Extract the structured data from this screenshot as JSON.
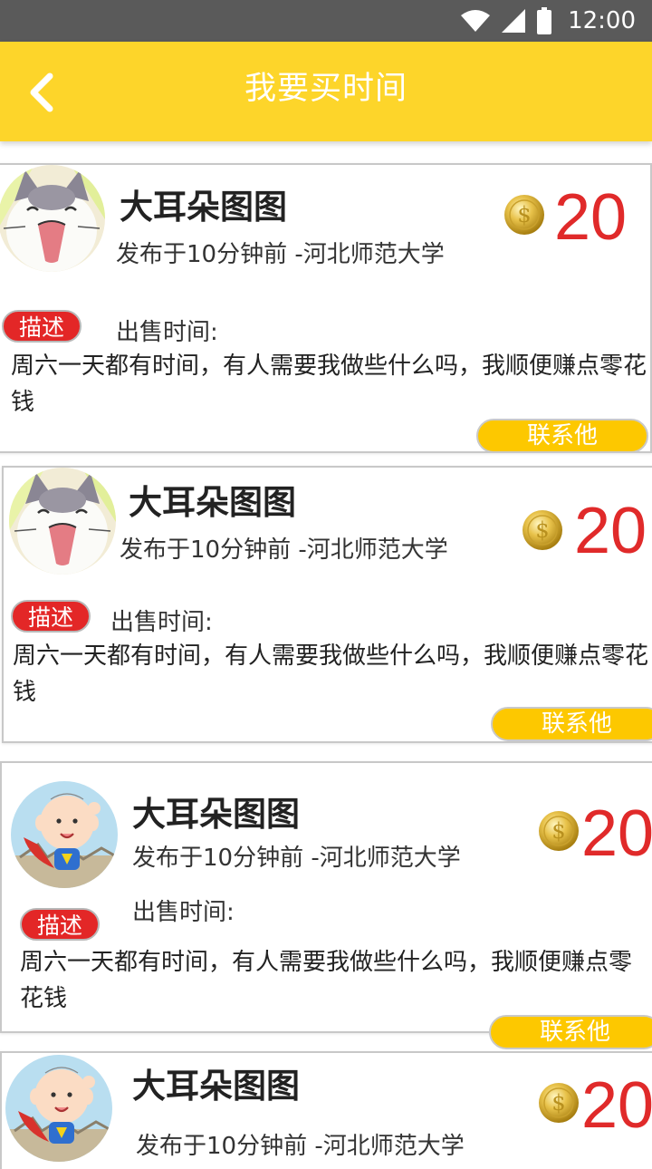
{
  "status_bar": {
    "time": "12:00",
    "icons": [
      "wifi-icon",
      "signal-icon",
      "battery-icon"
    ]
  },
  "app_bar": {
    "title": "我要买时间",
    "back_icon": "chevron-left-icon"
  },
  "colors": {
    "accent": "#fdd52a",
    "price": "#e02a2a",
    "tag": "#e32727",
    "button": "#fdc800"
  },
  "listings": [
    {
      "avatar": "kitten-avatar",
      "name": "大耳朵图图",
      "meta": "发布于10分钟前 -河北师范大学",
      "price": "20",
      "tag": "描述",
      "sale_label": "出售时间:",
      "description": "周六一天都有时间，有人需要我做些什么吗，我顺便赚点零花钱",
      "contact_label": "联系他"
    },
    {
      "avatar": "kitten-avatar",
      "name": "大耳朵图图",
      "meta": "发布于10分钟前 -河北师范大学",
      "price": "20",
      "tag": "描述",
      "sale_label": "出售时间:",
      "description": "周六一天都有时间，有人需要我做些什么吗，我顺便赚点零花钱",
      "contact_label": "联系他"
    },
    {
      "avatar": "superhero-baby-avatar",
      "name": "大耳朵图图",
      "meta": "发布于10分钟前 -河北师范大学",
      "price": "20",
      "tag": "描述",
      "sale_label": "出售时间:",
      "description": "周六一天都有时间，有人需要我做些什么吗，我顺便赚点零花钱",
      "contact_label": "联系他"
    },
    {
      "avatar": "superhero-baby-avatar",
      "name": "大耳朵图图",
      "meta": "发布于10分钟前 -河北师范大学",
      "price": "20"
    }
  ]
}
